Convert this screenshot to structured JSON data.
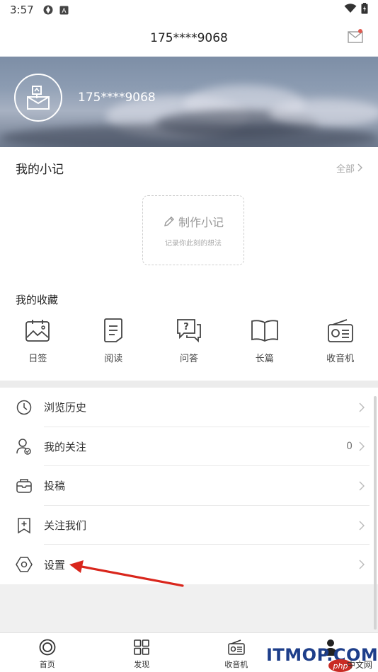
{
  "status_bar": {
    "time": "3:57"
  },
  "header": {
    "title": "175****9068",
    "mail_icon": "mail-icon"
  },
  "profile": {
    "username": "175****9068",
    "avatar_icon": "mailbox-icon"
  },
  "notes": {
    "title": "我的小记",
    "more_label": "全部",
    "make_label": "制作小记",
    "make_hint": "记录你此刻的想法"
  },
  "favorites": {
    "title": "我的收藏",
    "items": [
      {
        "label": "日签",
        "icon": "photo-icon"
      },
      {
        "label": "阅读",
        "icon": "document-icon"
      },
      {
        "label": "问答",
        "icon": "qa-icon"
      },
      {
        "label": "长篇",
        "icon": "book-icon"
      },
      {
        "label": "收音机",
        "icon": "radio-icon"
      }
    ]
  },
  "menu": [
    {
      "label": "浏览历史",
      "icon": "clock-icon",
      "count": ""
    },
    {
      "label": "我的关注",
      "icon": "user-follow-icon",
      "count": "0"
    },
    {
      "label": "投稿",
      "icon": "submit-icon",
      "count": ""
    },
    {
      "label": "关注我们",
      "icon": "bookmark-add-icon",
      "count": ""
    },
    {
      "label": "设置",
      "icon": "settings-icon",
      "count": ""
    }
  ],
  "tabs": [
    {
      "label": "首页",
      "icon": "home-ring-icon"
    },
    {
      "label": "发现",
      "icon": "grid-icon"
    },
    {
      "label": "收音机",
      "icon": "radio-icon"
    },
    {
      "label": "",
      "icon": "profile-icon"
    }
  ],
  "watermark": {
    "main": "ITMOP.COM",
    "php": "php",
    "sub": "中文网"
  },
  "colors": {
    "accent_red": "#d9261c",
    "banner": "#8c9cb2"
  }
}
